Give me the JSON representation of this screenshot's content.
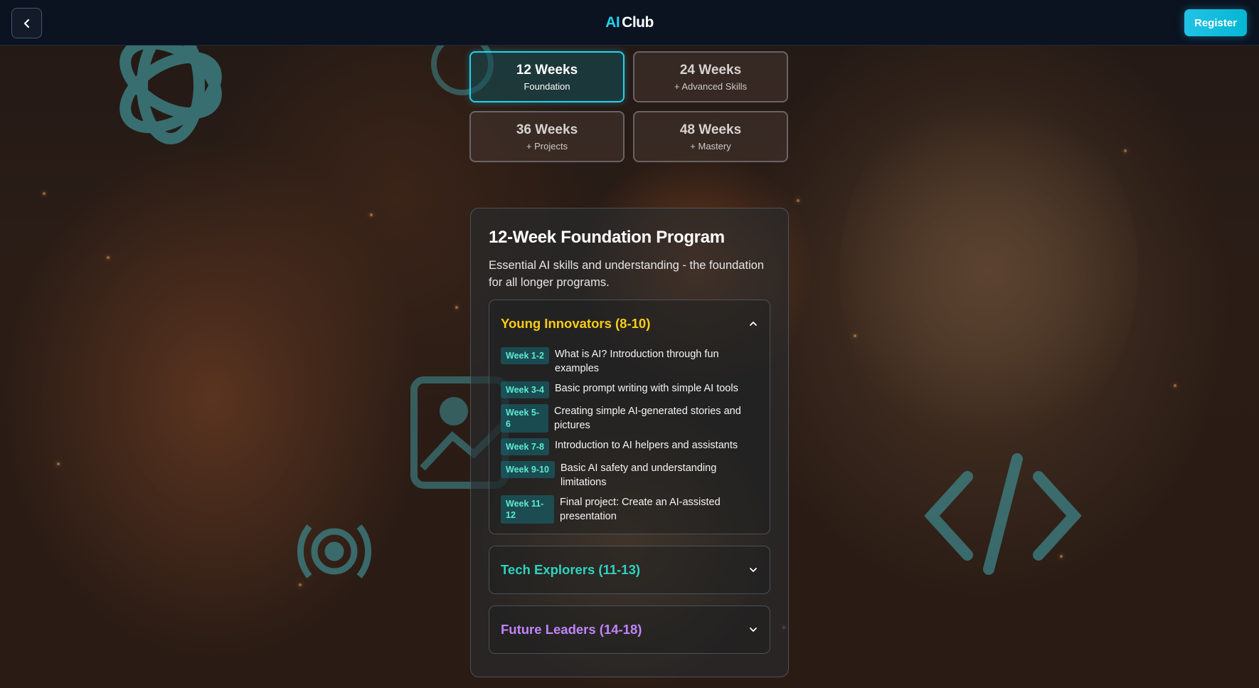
{
  "header": {
    "brand_ai": "AI",
    "brand_club": "Club",
    "register_label": "Register",
    "back_icon": "chevron-left-icon"
  },
  "tiles": [
    {
      "title": "12 Weeks",
      "subtitle": "Foundation",
      "active": true
    },
    {
      "title": "24 Weeks",
      "subtitle": "+ Advanced Skills",
      "active": false
    },
    {
      "title": "36 Weeks",
      "subtitle": "+ Projects",
      "active": false
    },
    {
      "title": "48 Weeks",
      "subtitle": "+ Mastery",
      "active": false
    }
  ],
  "program": {
    "title": "12-Week Foundation Program",
    "description": "Essential AI skills and understanding - the foundation for all longer programs."
  },
  "groups": [
    {
      "title": "Young Innovators (8-10)",
      "color": "#facc15",
      "expanded": true,
      "weeks": [
        {
          "badge": "Week 1-2",
          "text": "What is AI? Introduction through fun examples"
        },
        {
          "badge": "Week 3-4",
          "text": "Basic prompt writing with simple AI tools"
        },
        {
          "badge": "Week 5-6",
          "text": "Creating simple AI-generated stories and pictures"
        },
        {
          "badge": "Week 7-8",
          "text": "Introduction to AI helpers and assistants"
        },
        {
          "badge": "Week 9-10",
          "text": "Basic AI safety and understanding limitations"
        },
        {
          "badge": "Week 11-12",
          "text": "Final project: Create an AI-assisted presentation"
        }
      ]
    },
    {
      "title": "Tech Explorers (11-13)",
      "color": "#2dd4bf",
      "expanded": false
    },
    {
      "title": "Future Leaders (14-18)",
      "color": "#c084fc",
      "expanded": false
    }
  ],
  "colors": {
    "accent": "#22d3ee",
    "header_bg": "#0b1220"
  }
}
